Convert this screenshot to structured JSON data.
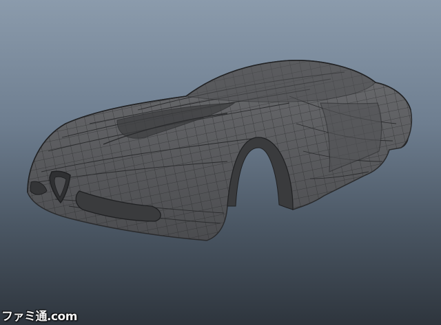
{
  "viewport": {
    "background_top": "#8b9bac",
    "background_bottom": "#2e353d",
    "model": {
      "name": "car-body-wireframe-model",
      "shading": "flat-gray-with-wireframe",
      "surface_color": "#5e5f61",
      "dark_surface_color": "#3d3e40",
      "wire_color": "#2a2b2d"
    }
  },
  "watermark": {
    "text": "ファミ通.com"
  }
}
